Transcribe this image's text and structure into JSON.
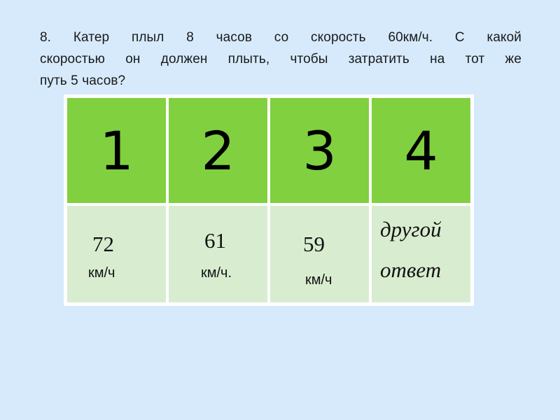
{
  "question": {
    "lines": [
      "8. Катер плыл 8 часов со скорость 60км/ч. С какой",
      "скоростью он должен плыть, чтобы  затратить на тот же",
      "путь 5 часов?"
    ]
  },
  "answers": [
    {
      "number": "1",
      "value": "72",
      "unit": "км/ч"
    },
    {
      "number": "2",
      "value": "61",
      "unit": "км/ч."
    },
    {
      "number": "3",
      "value": "59",
      "unit": "км/ч"
    },
    {
      "number": "4",
      "text_line1": "другой",
      "text_line2": "ответ"
    }
  ],
  "colors": {
    "background": "#d6eafc",
    "header_cell": "#80d040",
    "body_cell": "#d8edd0"
  }
}
